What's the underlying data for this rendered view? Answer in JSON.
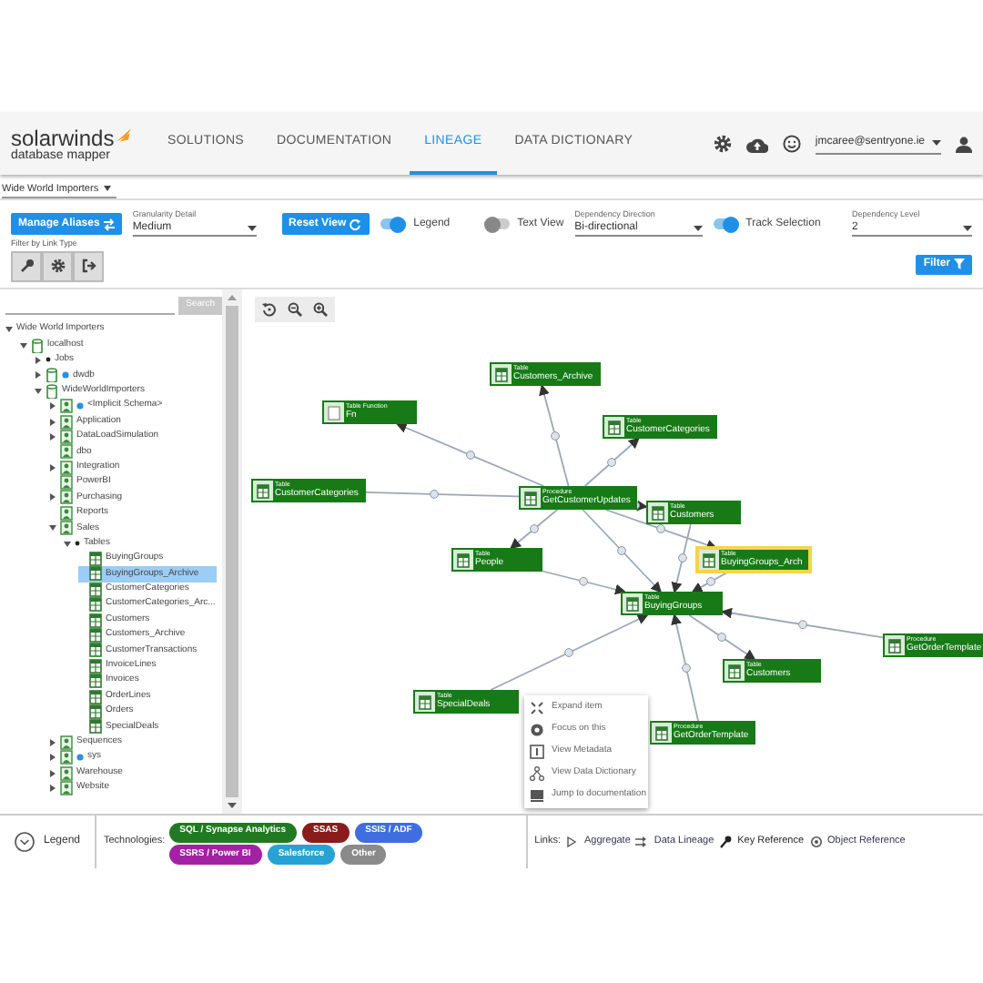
{
  "header": {
    "logo": {
      "brand": "solarwinds",
      "product": "database mapper"
    },
    "nav": [
      {
        "label": "SOLUTIONS",
        "selected": false
      },
      {
        "label": "DOCUMENTATION",
        "selected": false
      },
      {
        "label": "LINEAGE",
        "selected": true
      },
      {
        "label": "DATA DICTIONARY",
        "selected": false
      }
    ],
    "user": "jmcaree@sentryone.ie"
  },
  "database_selector": "Wide World Importers",
  "toolbar": {
    "manage_aliases": "Manage Aliases",
    "granularity": {
      "label": "Granularity Detail",
      "value": "Medium"
    },
    "reset_view": "Reset View",
    "toggles": [
      {
        "label": "Legend",
        "on": true
      },
      {
        "label": "Text View",
        "on": false
      }
    ],
    "dependency_direction": {
      "label": "Dependency Direction",
      "value": "Bi-directional"
    },
    "track_selection": {
      "label": "Track Selection",
      "on": true
    },
    "dependency_level": {
      "label": "Dependency Level",
      "value": "2"
    },
    "filter_by_link_type": "Filter by Link Type",
    "filter": "Filter"
  },
  "tree": {
    "search_button": "Search",
    "nodes": [
      {
        "label": "Wide World Importers",
        "expanded": true,
        "children": [
          {
            "label": "localhost",
            "kind": "database",
            "expanded": true,
            "children": [
              {
                "label": "Jobs",
                "kind": "bullet",
                "expanded": false
              },
              {
                "label": "dwdb",
                "kind": "database",
                "dot": true,
                "expanded": false
              },
              {
                "label": "WideWorldImporters",
                "kind": "database",
                "expanded": true,
                "children": [
                  {
                    "label": "<Implicit Schema>",
                    "kind": "schema",
                    "dot": true,
                    "expanded": false
                  },
                  {
                    "label": "Application",
                    "kind": "schema",
                    "expanded": false
                  },
                  {
                    "label": "DataLoadSimulation",
                    "kind": "schema",
                    "expanded": false
                  },
                  {
                    "label": "dbo",
                    "kind": "schema"
                  },
                  {
                    "label": "Integration",
                    "kind": "schema",
                    "expanded": false
                  },
                  {
                    "label": "PowerBI",
                    "kind": "schema"
                  },
                  {
                    "label": "Purchasing",
                    "kind": "schema",
                    "expanded": false
                  },
                  {
                    "label": "Reports",
                    "kind": "schema"
                  },
                  {
                    "label": "Sales",
                    "kind": "schema",
                    "expanded": true,
                    "children": [
                      {
                        "label": "Tables",
                        "kind": "bullet",
                        "expanded": true,
                        "children": [
                          {
                            "label": "BuyingGroups",
                            "kind": "table",
                            "selected": false
                          },
                          {
                            "label": "BuyingGroups_Archive",
                            "kind": "table",
                            "selected": true
                          },
                          {
                            "label": "CustomerCategories",
                            "kind": "table",
                            "selected": false
                          },
                          {
                            "label": "CustomerCategories_Arc...",
                            "kind": "table",
                            "selected": false
                          },
                          {
                            "label": "Customers",
                            "kind": "table",
                            "selected": false
                          },
                          {
                            "label": "Customers_Archive",
                            "kind": "table",
                            "selected": false
                          },
                          {
                            "label": "CustomerTransactions",
                            "kind": "table",
                            "selected": false
                          },
                          {
                            "label": "InvoiceLines",
                            "kind": "table",
                            "selected": false
                          },
                          {
                            "label": "Invoices",
                            "kind": "table",
                            "selected": false
                          },
                          {
                            "label": "OrderLines",
                            "kind": "table",
                            "selected": false
                          },
                          {
                            "label": "Orders",
                            "kind": "table",
                            "selected": false
                          },
                          {
                            "label": "SpecialDeals",
                            "kind": "table",
                            "selected": false
                          }
                        ]
                      }
                    ]
                  },
                  {
                    "label": "Sequences",
                    "kind": "schema",
                    "expanded": false
                  },
                  {
                    "label": "sys",
                    "kind": "schema",
                    "dot": true,
                    "expanded": false
                  },
                  {
                    "label": "Warehouse",
                    "kind": "schema",
                    "expanded": false
                  },
                  {
                    "label": "Website",
                    "kind": "schema",
                    "expanded": false
                  }
                ]
              }
            ]
          }
        ]
      }
    ]
  },
  "graph": {
    "nodes": [
      {
        "type": "Table",
        "name": "Customers_Archive",
        "kind": "table",
        "selected": false
      },
      {
        "type": "Table Function",
        "name": "Fn",
        "kind": "function",
        "selected": false
      },
      {
        "type": "Table",
        "name": "CustomerCategories",
        "kind": "table",
        "selected": false
      },
      {
        "type": "Table",
        "name": "CustomerCategories",
        "kind": "table",
        "selected": false
      },
      {
        "type": "Procedure",
        "name": "GetCustomerUpdates",
        "kind": "table",
        "selected": false
      },
      {
        "type": "Table",
        "name": "Customers",
        "kind": "table",
        "selected": false
      },
      {
        "type": "Table",
        "name": "People",
        "kind": "table",
        "selected": false
      },
      {
        "type": "Table",
        "name": "BuyingGroups_Arch",
        "kind": "table",
        "selected": true
      },
      {
        "type": "Table",
        "name": "BuyingGroups",
        "kind": "table",
        "selected": false
      },
      {
        "type": "Procedure",
        "name": "GetOrderTemplate",
        "kind": "table",
        "selected": false
      },
      {
        "type": "Table",
        "name": "Customers",
        "kind": "table",
        "selected": false
      },
      {
        "type": "Table",
        "name": "SpecialDeals",
        "kind": "table",
        "selected": false
      },
      {
        "type": "Procedure",
        "name": "GetOrderTemplate",
        "kind": "table",
        "selected": false
      }
    ],
    "context_menu": [
      {
        "label": "Expand item",
        "kind": "expand"
      },
      {
        "label": "Focus on this",
        "kind": "focus"
      },
      {
        "label": "View Metadata",
        "kind": "metadata"
      },
      {
        "label": "View Data Dictionary",
        "kind": "dictionary"
      },
      {
        "label": "Jump to documentation",
        "kind": "docs"
      }
    ]
  },
  "legend": {
    "label": "Legend",
    "technologies_label": "Technologies:",
    "technologies": [
      {
        "label": "SQL / Synapse Analytics",
        "color": "#217a21"
      },
      {
        "label": "SSAS",
        "color": "#8b1c1c"
      },
      {
        "label": "SSIS / ADF",
        "color": "#3f6ee0"
      },
      {
        "label": "SSRS / Power BI",
        "color": "#a321a3"
      },
      {
        "label": "Salesforce",
        "color": "#26a3d4"
      },
      {
        "label": "Other",
        "color": "#8a8a8a"
      }
    ],
    "links_label": "Links:",
    "links": [
      {
        "label": "Aggregate",
        "kind": "aggregate"
      },
      {
        "label": "Data Lineage",
        "kind": "lineage"
      },
      {
        "label": "Key Reference",
        "kind": "key"
      },
      {
        "label": "Object Reference",
        "kind": "object"
      }
    ]
  }
}
